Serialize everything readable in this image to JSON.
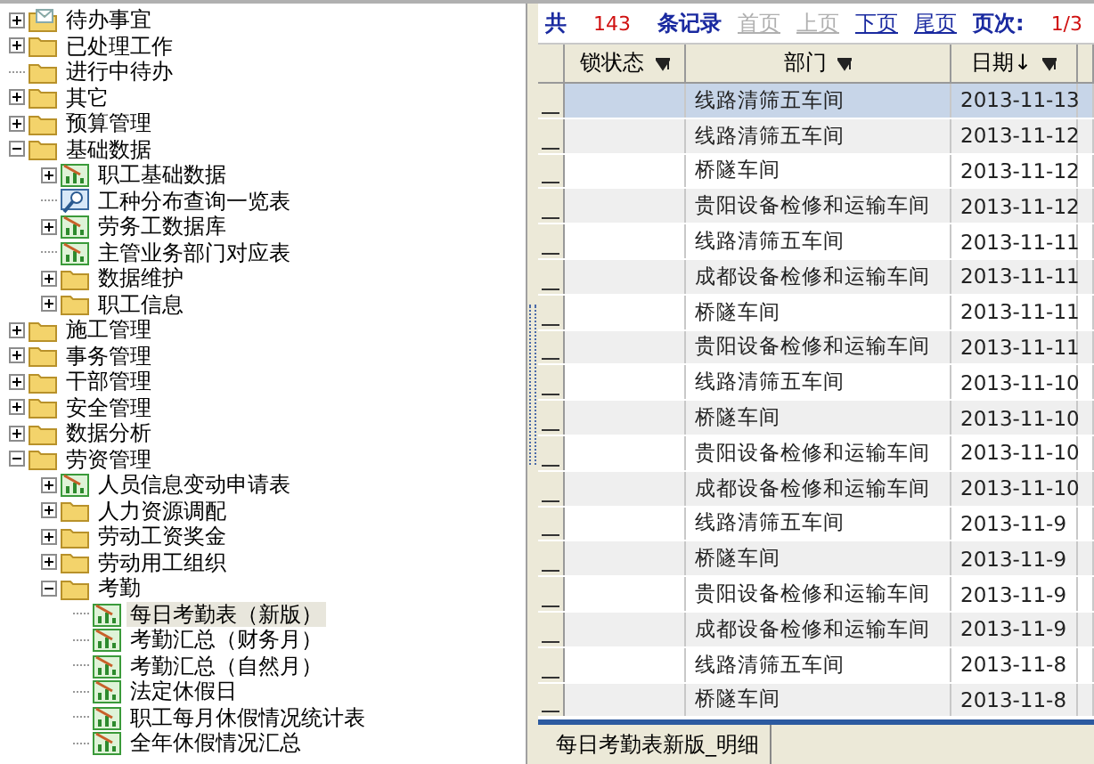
{
  "tree": [
    {
      "label": "待办事宜",
      "kind": "mail",
      "expanded": false,
      "selected": false
    },
    {
      "label": "已处理工作",
      "kind": "folder",
      "expanded": false,
      "selected": false
    },
    {
      "label": "进行中待办",
      "kind": "folder",
      "selected": false
    },
    {
      "label": "其它",
      "kind": "folder",
      "expanded": false,
      "selected": false
    },
    {
      "label": "预算管理",
      "kind": "folder",
      "expanded": false,
      "selected": false
    },
    {
      "label": "基础数据",
      "kind": "folder",
      "expanded": true,
      "selected": false,
      "children": [
        {
          "label": "职工基础数据",
          "kind": "report",
          "expanded": false,
          "selected": false
        },
        {
          "label": "工种分布查询一览表",
          "kind": "query",
          "selected": false
        },
        {
          "label": "劳务工数据库",
          "kind": "report",
          "expanded": false,
          "selected": false
        },
        {
          "label": "主管业务部门对应表",
          "kind": "report",
          "selected": false
        },
        {
          "label": "数据维护",
          "kind": "folder",
          "expanded": false,
          "selected": false
        },
        {
          "label": "职工信息",
          "kind": "folder",
          "expanded": false,
          "selected": false
        }
      ]
    },
    {
      "label": "施工管理",
      "kind": "folder",
      "expanded": false,
      "selected": false
    },
    {
      "label": "事务管理",
      "kind": "folder",
      "expanded": false,
      "selected": false
    },
    {
      "label": "干部管理",
      "kind": "folder",
      "expanded": false,
      "selected": false
    },
    {
      "label": "安全管理",
      "kind": "folder",
      "expanded": false,
      "selected": false
    },
    {
      "label": "数据分析",
      "kind": "folder",
      "expanded": false,
      "selected": false
    },
    {
      "label": "劳资管理",
      "kind": "folder",
      "expanded": true,
      "selected": false,
      "children": [
        {
          "label": "人员信息变动申请表",
          "kind": "report",
          "expanded": false,
          "selected": false
        },
        {
          "label": "人力资源调配",
          "kind": "folder",
          "expanded": false,
          "selected": false
        },
        {
          "label": "劳动工资奖金",
          "kind": "folder",
          "expanded": false,
          "selected": false
        },
        {
          "label": "劳动用工组织",
          "kind": "folder",
          "expanded": false,
          "selected": false
        },
        {
          "label": "考勤",
          "kind": "folder",
          "expanded": true,
          "selected": false,
          "children": [
            {
              "label": "每日考勤表（新版）",
              "kind": "report",
              "selected": true
            },
            {
              "label": "考勤汇总（财务月）",
              "kind": "report",
              "selected": false
            },
            {
              "label": "考勤汇总（自然月）",
              "kind": "report",
              "selected": false
            },
            {
              "label": "法定休假日",
              "kind": "report",
              "selected": false
            },
            {
              "label": "职工每月休假情况统计表",
              "kind": "report",
              "selected": false
            },
            {
              "label": "全年休假情况汇总",
              "kind": "report",
              "selected": false
            }
          ]
        }
      ]
    }
  ],
  "pager": [
    {
      "text": "共",
      "kind": "label"
    },
    {
      "text": "143",
      "kind": "count"
    },
    {
      "text": "条记录",
      "kind": "label"
    },
    {
      "text": "首页",
      "kind": "link",
      "disabled": true
    },
    {
      "text": "上页",
      "kind": "link",
      "disabled": true
    },
    {
      "text": "下页",
      "kind": "link",
      "disabled": false
    },
    {
      "text": "尾页",
      "kind": "link",
      "disabled": false
    },
    {
      "text": "页次:",
      "kind": "label"
    },
    {
      "text": "1/3",
      "kind": "count"
    }
  ],
  "table": {
    "columns": [
      "锁状态",
      "部门",
      "日期↓"
    ],
    "rows": [
      {
        "department": "线路清筛五车间",
        "date": "2013-11-13",
        "selected": true
      },
      {
        "department": "线路清筛五车间",
        "date": "2013-11-12",
        "selected": false
      },
      {
        "department": "桥隧车间",
        "date": "2013-11-12",
        "selected": false
      },
      {
        "department": "贵阳设备检修和运输车间",
        "date": "2013-11-12",
        "selected": false
      },
      {
        "department": "线路清筛五车间",
        "date": "2013-11-11",
        "selected": false
      },
      {
        "department": "成都设备检修和运输车间",
        "date": "2013-11-11",
        "selected": false
      },
      {
        "department": "桥隧车间",
        "date": "2013-11-11",
        "selected": false
      },
      {
        "department": "贵阳设备检修和运输车间",
        "date": "2013-11-11",
        "selected": false
      },
      {
        "department": "线路清筛五车间",
        "date": "2013-11-10",
        "selected": false
      },
      {
        "department": "桥隧车间",
        "date": "2013-11-10",
        "selected": false
      },
      {
        "department": "贵阳设备检修和运输车间",
        "date": "2013-11-10",
        "selected": false
      },
      {
        "department": "成都设备检修和运输车间",
        "date": "2013-11-10",
        "selected": false
      },
      {
        "department": "线路清筛五车间",
        "date": "2013-11-9",
        "selected": false
      },
      {
        "department": "桥隧车间",
        "date": "2013-11-9",
        "selected": false
      },
      {
        "department": "贵阳设备检修和运输车间",
        "date": "2013-11-9",
        "selected": false
      },
      {
        "department": "成都设备检修和运输车间",
        "date": "2013-11-9",
        "selected": false
      },
      {
        "department": "线路清筛五车间",
        "date": "2013-11-8",
        "selected": false
      },
      {
        "department": "桥隧车间",
        "date": "2013-11-8",
        "selected": false
      }
    ]
  },
  "tabs": [
    {
      "label": "每日考勤表新版_明细",
      "selected": true
    }
  ]
}
